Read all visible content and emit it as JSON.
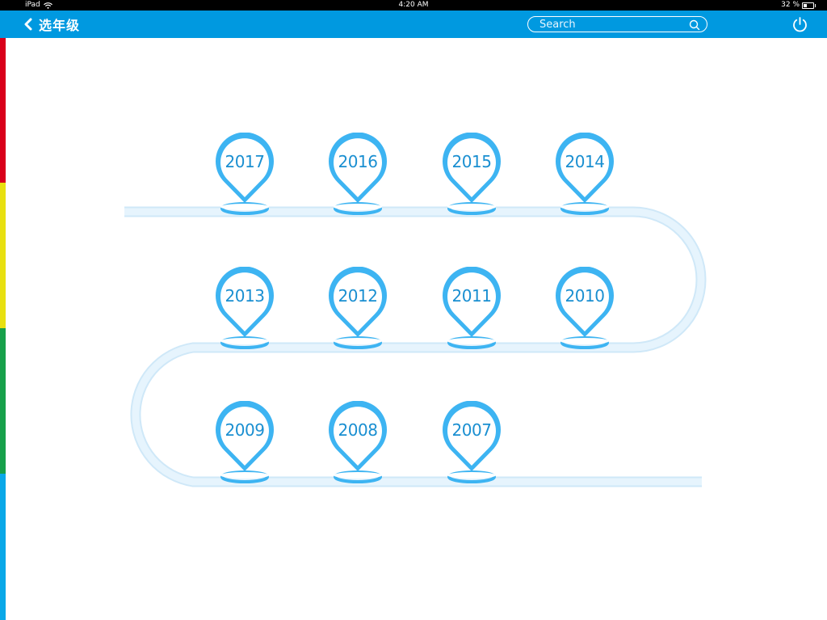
{
  "status_bar": {
    "device": "iPad",
    "time": "4:20 AM",
    "battery": "32 %",
    "battery_level": 0.32
  },
  "nav": {
    "back_icon": "chevron-left-icon",
    "title": "选年级",
    "search_placeholder": "Search",
    "search_icon": "search-icon",
    "power_icon": "power-icon"
  },
  "colors": {
    "nav_bg": "#0099e0",
    "pin": "#3db4f2",
    "pin_text": "#1a8fd1",
    "track": "#d6ecfa",
    "strip": [
      "#d9001b",
      "#e8e010",
      "#16a04a",
      "#0aa8e8"
    ]
  },
  "years": [
    {
      "label": "2017"
    },
    {
      "label": "2016"
    },
    {
      "label": "2015"
    },
    {
      "label": "2014"
    },
    {
      "label": "2013"
    },
    {
      "label": "2012"
    },
    {
      "label": "2011"
    },
    {
      "label": "2010"
    },
    {
      "label": "2009"
    },
    {
      "label": "2008"
    },
    {
      "label": "2007"
    }
  ]
}
